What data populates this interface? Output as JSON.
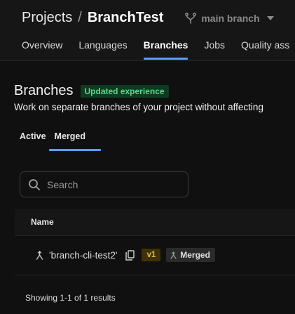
{
  "breadcrumb": {
    "projects": "Projects",
    "separator": "/",
    "project": "BranchTest"
  },
  "branch_selector": {
    "label": "main branch",
    "icon": "branch-icon"
  },
  "nav_tabs": [
    {
      "label": "Overview",
      "active": false
    },
    {
      "label": "Languages",
      "active": false
    },
    {
      "label": "Branches",
      "active": true
    },
    {
      "label": "Jobs",
      "active": false
    },
    {
      "label": "Quality ass",
      "active": false
    }
  ],
  "page": {
    "title": "Branches",
    "badge": "Updated experience",
    "subtitle": "Work on separate branches of your project without affecting"
  },
  "subtabs": [
    {
      "label": "Active",
      "active": false
    },
    {
      "label": "Merged",
      "active": true
    }
  ],
  "search": {
    "placeholder": "Search",
    "value": ""
  },
  "table": {
    "columns": [
      "Name"
    ],
    "rows": [
      {
        "name": "'branch-cli-test2'",
        "version": "v1",
        "status": "Merged"
      }
    ]
  },
  "footer": {
    "count": "Showing 1-1 of 1 results"
  },
  "colors": {
    "accent": "#5b9df5",
    "badge_green_bg": "#0f3b22",
    "badge_green_text": "#5fd58a",
    "version_bg": "#3f3208",
    "version_text": "#e8b64a"
  }
}
